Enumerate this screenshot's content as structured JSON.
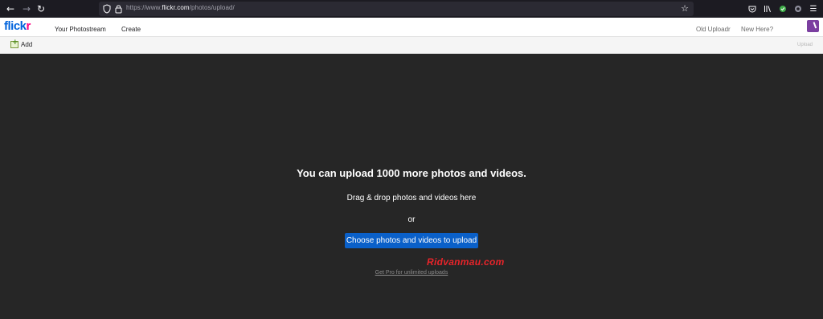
{
  "browser": {
    "url_prefix": "https://www.",
    "url_domain": "flickr.com",
    "url_path": "/photos/upload/"
  },
  "header": {
    "logo_part1": "flick",
    "logo_part2": "r",
    "nav": [
      "Your Photostream",
      "Create"
    ],
    "old_uploadr": "Old Uploadr",
    "new_here": "New Here?"
  },
  "toolbar": {
    "add_label": "Add",
    "upload_label": "Upload"
  },
  "main": {
    "headline": "You can upload 1000 more photos and videos.",
    "drag_text": "Drag & drop photos and videos here",
    "or_text": "or",
    "choose_button": "Choose photos and videos to upload",
    "watermark": "Ridvanmau.com",
    "get_pro": "Get Pro for unlimited uploads"
  },
  "colors": {
    "flickr_blue": "#0063dc",
    "flickr_pink": "#ff0084",
    "button_blue": "#0a60c9",
    "background": "#262626"
  }
}
